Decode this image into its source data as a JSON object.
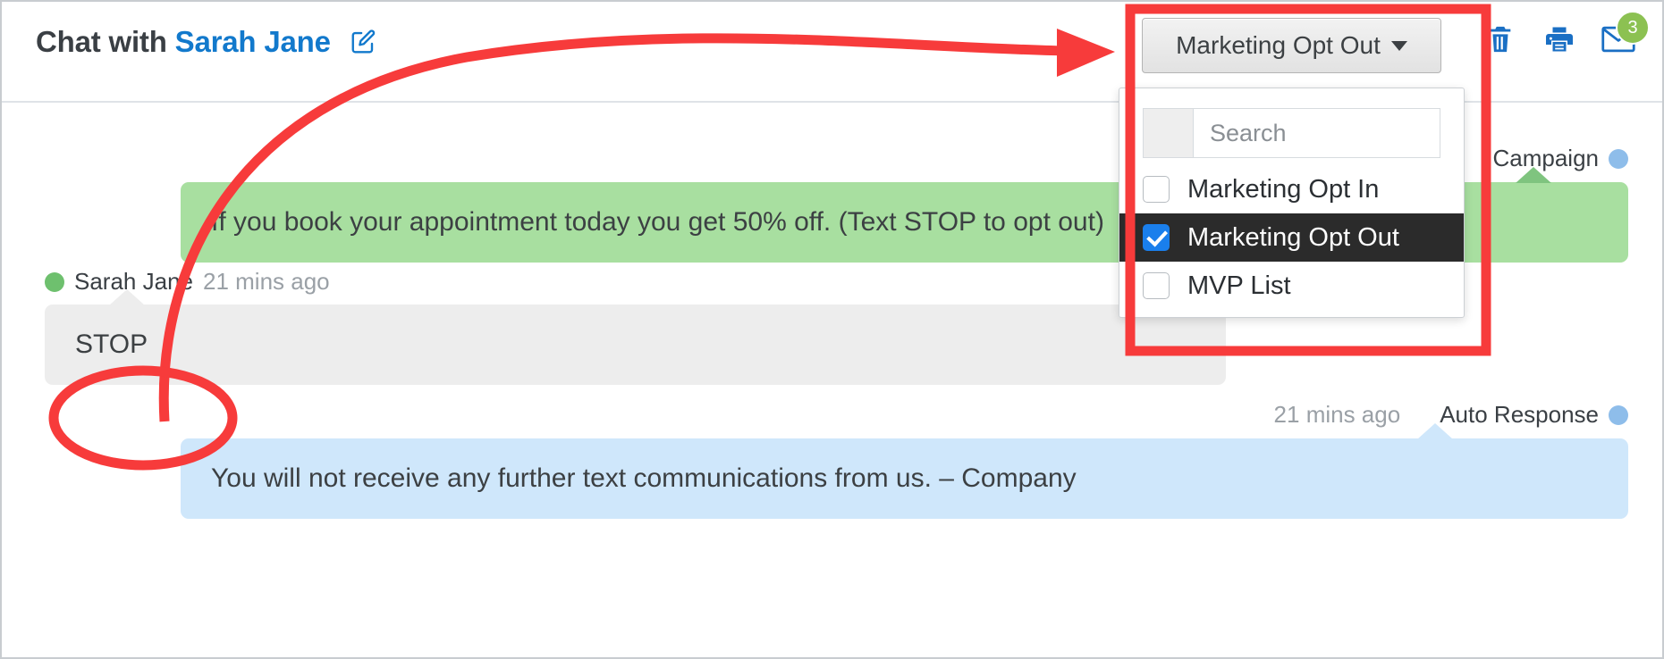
{
  "header": {
    "title_prefix": "Chat with ",
    "contact_name": "Sarah Jane",
    "edit_icon": "edit-pencil-square-icon",
    "actions": [
      {
        "name": "delete-button",
        "icon": "trash-icon"
      },
      {
        "name": "print-button",
        "icon": "printer-icon"
      },
      {
        "name": "email-button",
        "icon": "envelope-icon",
        "badge": "3"
      }
    ]
  },
  "dropdown": {
    "toggle_label": "Marketing Opt Out",
    "caret_icon": "chevron-down-icon",
    "search": {
      "placeholder": "Search",
      "value": ""
    },
    "options": [
      {
        "label": "Marketing Opt In",
        "checked": false
      },
      {
        "label": "Marketing Opt Out",
        "checked": true
      },
      {
        "label": "MVP List",
        "checked": false
      }
    ]
  },
  "messages": [
    {
      "id": "campaign",
      "direction": "outbound",
      "sender_label": "Campaign",
      "timestamp": "",
      "dot_color": "#8ebdea",
      "text": "If you book your appointment today you get 50% off. (Text STOP to opt out)",
      "bubble_color": "#a8dfa0"
    },
    {
      "id": "inbound",
      "direction": "inbound",
      "sender_label": "Sarah Jane",
      "timestamp": "21 mins ago",
      "dot_color": "#6ec06e",
      "text": "STOP",
      "bubble_color": "#ededed"
    },
    {
      "id": "auto",
      "direction": "outbound",
      "sender_label": "Auto Response",
      "timestamp": "21 mins ago",
      "dot_color": "#8ebdea",
      "text": "You will not receive any further text communications from us. – Company",
      "bubble_color": "#cfe7fb"
    }
  ],
  "annotations": {
    "highlight_color": "#f73b3b",
    "arrow_name": "red-annotation-arrow",
    "box_name": "red-annotation-box",
    "ellipse_name": "red-annotation-ellipse"
  },
  "colors": {
    "link_blue": "#1279cc",
    "icon_blue": "#1a6fc4",
    "badge_green": "#8cc152",
    "selected_row_bg": "#2b2b2b",
    "checkbox_blue": "#1a7fec"
  }
}
